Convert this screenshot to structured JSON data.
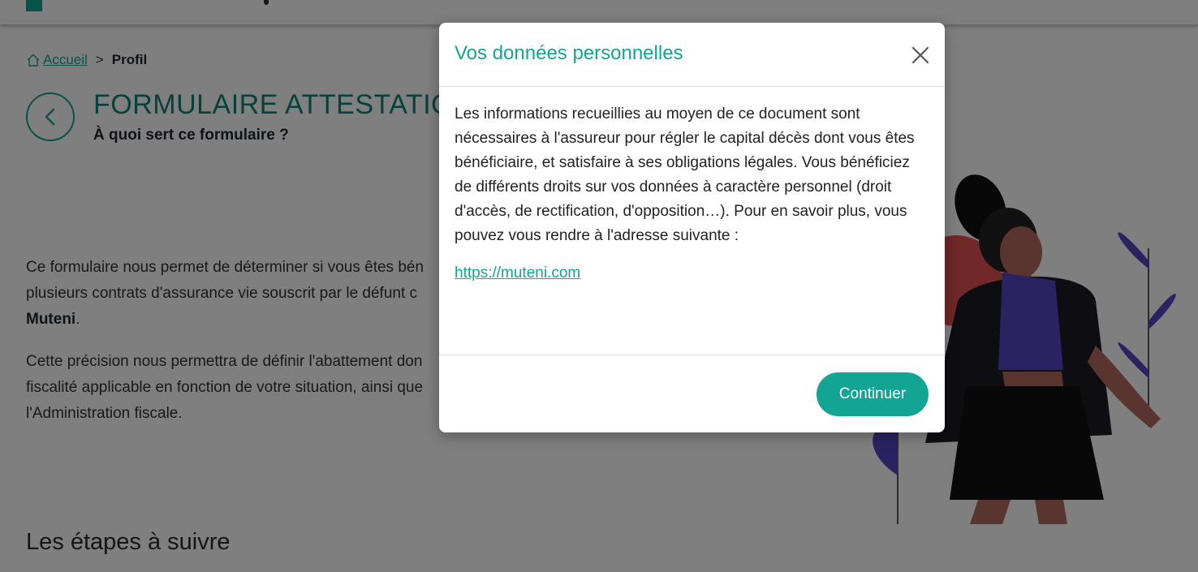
{
  "breadcrumb": {
    "home": "Accueil",
    "separator": ">",
    "current": "Profil"
  },
  "page": {
    "title": "FORMULAIRE ATTESTATION",
    "subtitle": "À quoi sert ce formulaire ?",
    "para1_a": "Ce formulaire nous permet de déterminer si vous êtes bén",
    "para1_b": "plusieurs contrats d'assurance vie souscrit par le défunt c",
    "para1_bold": "Muteni",
    "para1_end": ".",
    "para2_a": "Cette précision nous permettra de définir l'abattement don",
    "para2_b": "fiscalité applicable en fonction de votre situation, ainsi que",
    "para2_c": "l'Administration fiscale.",
    "section_title": "Les étapes à suivre"
  },
  "modal": {
    "title": "Vos données personnelles",
    "body": "Les informations recueillies au moyen de ce document sont nécessaires à l'assureur pour régler le capital décès dont vous êtes bénéficiaire, et satisfaire à ses obligations légales. Vous bénéficiez de différents droits sur vos données à caractère personnel (droit d'accès, de rectification, d'opposition…). Pour en savoir plus, vous pouvez vous rendre à l'adresse suivante :",
    "link": "https://muteni.com",
    "button": "Continuer"
  },
  "icons": {
    "home": "home-icon",
    "back": "chevron-left-icon",
    "close": "close-icon"
  },
  "colors": {
    "accent": "#12a594",
    "title": "#0c8577",
    "overlay": "rgba(0,0,0,0.5)"
  }
}
